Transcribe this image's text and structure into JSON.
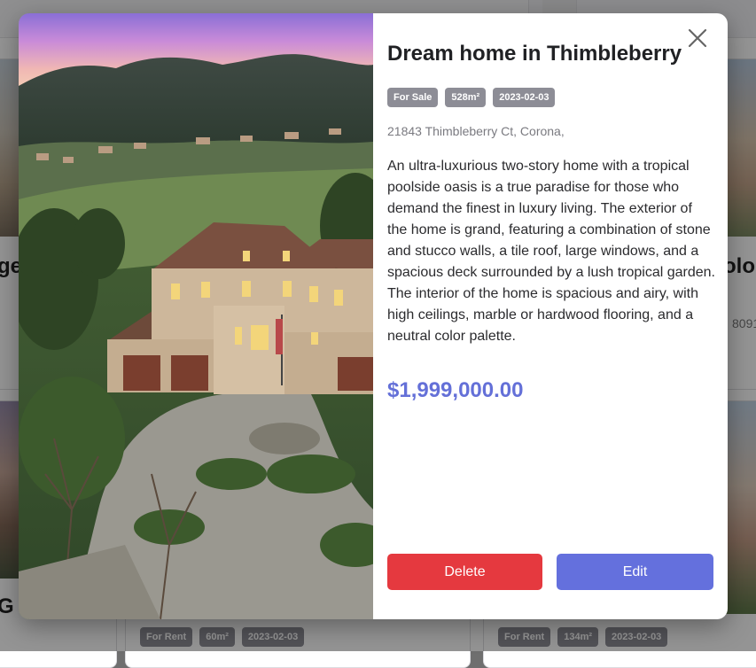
{
  "background": {
    "cards": [
      {
        "title_fragment": "ge"
      },
      {
        "title_fragment": "olo",
        "sub_fragment": "8091"
      },
      {
        "title_fragment": "G !"
      },
      {
        "tags": [
          "For Rent",
          "60m²",
          "2023-02-03"
        ]
      },
      {
        "tags": [
          "For Rent",
          "134m²",
          "2023-02-03"
        ]
      }
    ]
  },
  "modal": {
    "title": "Dream home in Thimbleberry",
    "tags": [
      "For Sale",
      "528m²",
      "2023-02-03"
    ],
    "address": "21843 Thimbleberry Ct, Corona,",
    "description": "An ultra-luxurious two-story home with a tropical poolside oasis is a true paradise for those who demand the finest in luxury living. The exterior of the home is grand, featuring a combination of stone and stucco walls, a tile roof, large windows, and a spacious deck surrounded by a lush tropical garden. The interior of the home is spacious and airy, with high ceilings, marble or hardwood flooring, and a neutral color palette.",
    "price": "$1,999,000.00",
    "delete_label": "Delete",
    "edit_label": "Edit",
    "close_icon": "close-icon"
  },
  "colors": {
    "price": "#6470d8",
    "delete": "#e5393f",
    "edit": "#6470dd",
    "tag_bg": "#8d8d96"
  }
}
